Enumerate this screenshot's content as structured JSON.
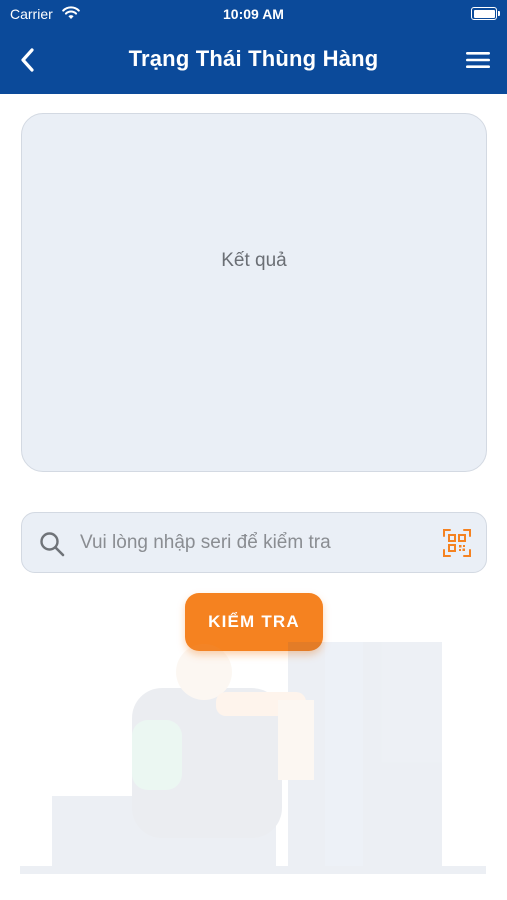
{
  "status_bar": {
    "carrier": "Carrier",
    "time": "10:09 AM"
  },
  "header": {
    "title": "Trạng Thái Thùng Hàng",
    "back_icon": "chevron-left-icon",
    "menu_icon": "hamburger-menu-icon",
    "background_color": "#0b4a9a"
  },
  "result": {
    "placeholder": "Kết quả"
  },
  "search": {
    "placeholder": "Vui lòng nhập seri để kiểm tra",
    "value": "",
    "search_icon": "search-icon",
    "scan_icon": "qr-scan-icon"
  },
  "actions": {
    "check_label": "KIỂM TRA",
    "check_color": "#f58220"
  },
  "illustration": {
    "icon": "warehouse-worker-illustration"
  }
}
